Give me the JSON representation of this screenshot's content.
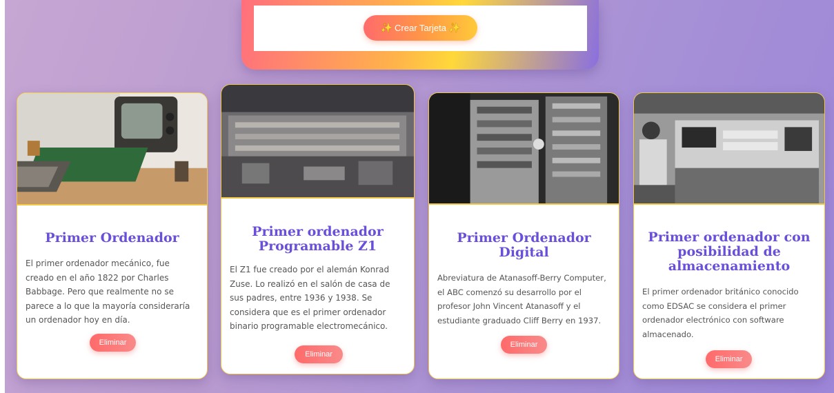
{
  "form": {
    "create_label": "Crear Tarjeta",
    "sparkle": "✨"
  },
  "cards": [
    {
      "title": "Primer Ordenador",
      "description": "El primer ordenador mecánico, fue creado en el año 1822 por Charles Babbage. Pero que realmente no se parece a lo que la mayoría consideraría un ordenador hoy en día.",
      "delete_label": "Eliminar"
    },
    {
      "title": "Primer ordenador Programable Z1",
      "description": "El Z1 fue creado por el alemán Konrad Zuse. Lo realizó en el salón de casa de sus padres, entre 1936 y 1938. Se considera que es el primer ordenador binario programable electromecánico.",
      "delete_label": "Eliminar"
    },
    {
      "title": "Primer Ordenador Digital",
      "description": "Abreviatura de Atanasoff-Berry Computer, el ABC comenzó su desarrollo por el profesor John Vincent Atanasoff y el estudiante graduado Cliff Berry en 1937.",
      "delete_label": "Eliminar"
    },
    {
      "title": "Primer ordenador con posibilidad de almacenamiento",
      "description": "El primer ordenador británico conocido como EDSAC se considera el primer ordenador electrónico con software almacenado.",
      "delete_label": "Eliminar"
    }
  ],
  "colors": {
    "title": "#6a4fd8",
    "accent_border": "#f3c94a",
    "delete_button": "#ff6a6a"
  }
}
